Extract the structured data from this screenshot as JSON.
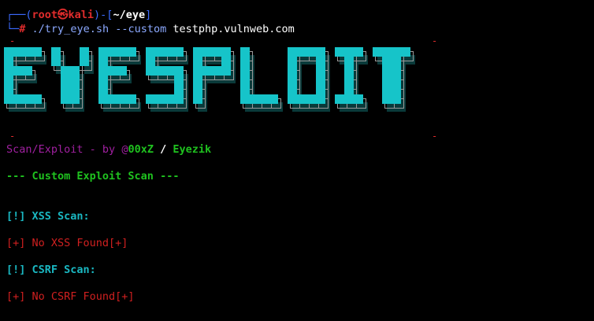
{
  "prompt": {
    "frame_top": "┌──(",
    "user": "root",
    "at_symbol": "㉿",
    "host": "kali",
    "mid": ")-[",
    "path": "~/eye",
    "end": "]",
    "frame_bottom": "└─",
    "hash": "#",
    "command": "./try_eye.sh --custom",
    "argument": "testphp.vulnweb.com"
  },
  "banner": {
    "text": "EYESPLOIT",
    "corner_mark": "-"
  },
  "credit": {
    "prefix": "Scan/Exploit - by ",
    "at": "@",
    "author": "00xZ",
    "slash": " / ",
    "coauthor": "Eyezik"
  },
  "sections": {
    "heading": "--- Custom Exploit Scan ---",
    "xss_title": "[!] XSS Scan:",
    "xss_result": "[+] No XSS Found[+]",
    "csrf_title": "[!] CSRF Scan:",
    "csrf_result": "[+] No CSRF Found[+]"
  },
  "colors": {
    "banner_face": "#16c4c9",
    "banner_shadow": "#0a3a3a",
    "prompt_frame": "#3b6bff",
    "accent_red": "#e02c2c"
  }
}
